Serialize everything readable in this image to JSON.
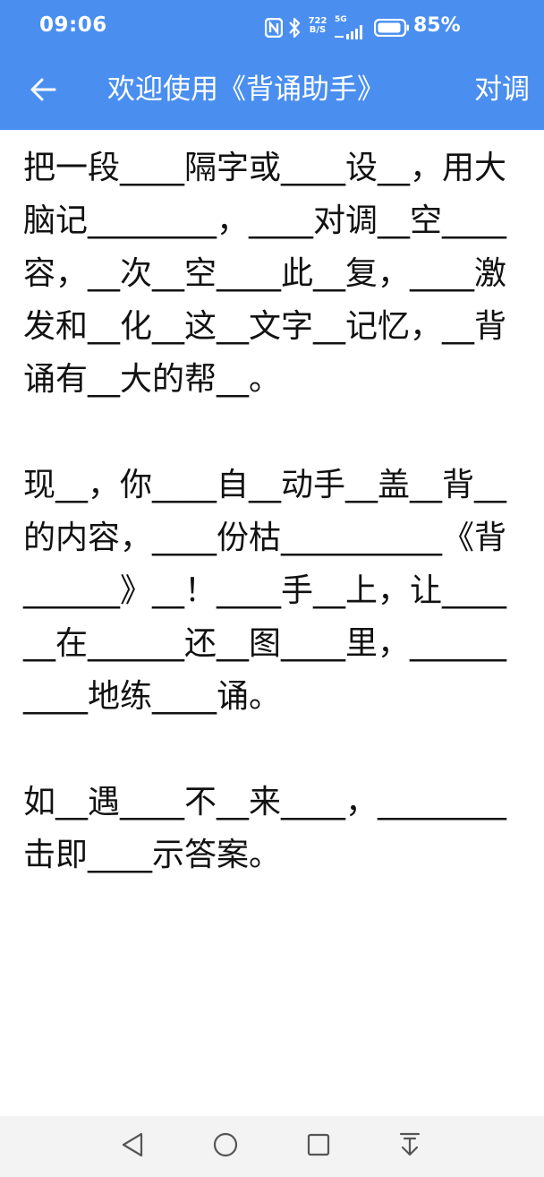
{
  "status_bar": {
    "time": "09:06",
    "net_speed_top": "722",
    "net_speed_bottom": "B/S",
    "net_type": "5G",
    "battery": "85%"
  },
  "toolbar": {
    "back_icon": "arrow-left-icon",
    "title": "欢迎使用《背诵助手》",
    "action_label": "对调"
  },
  "content": {
    "paragraphs": [
      "把一段____隔字或____设__，用大脑记________，____对调__空____容，__次__空____此__复，____激发和__化__这__文字__记忆，__背诵有__大的帮__。",
      "现__，你____自__动手__盖__背__的内容，____份枯__________《背______》__！____手__上，让______在______还__图____里，__________地练____诵。",
      "如__遇____不__来____，________击即____示答案。"
    ]
  },
  "navbar": {
    "back": "triangle-back-icon",
    "home": "circle-home-icon",
    "recents": "square-recents-icon",
    "down": "download-arrow-icon"
  }
}
